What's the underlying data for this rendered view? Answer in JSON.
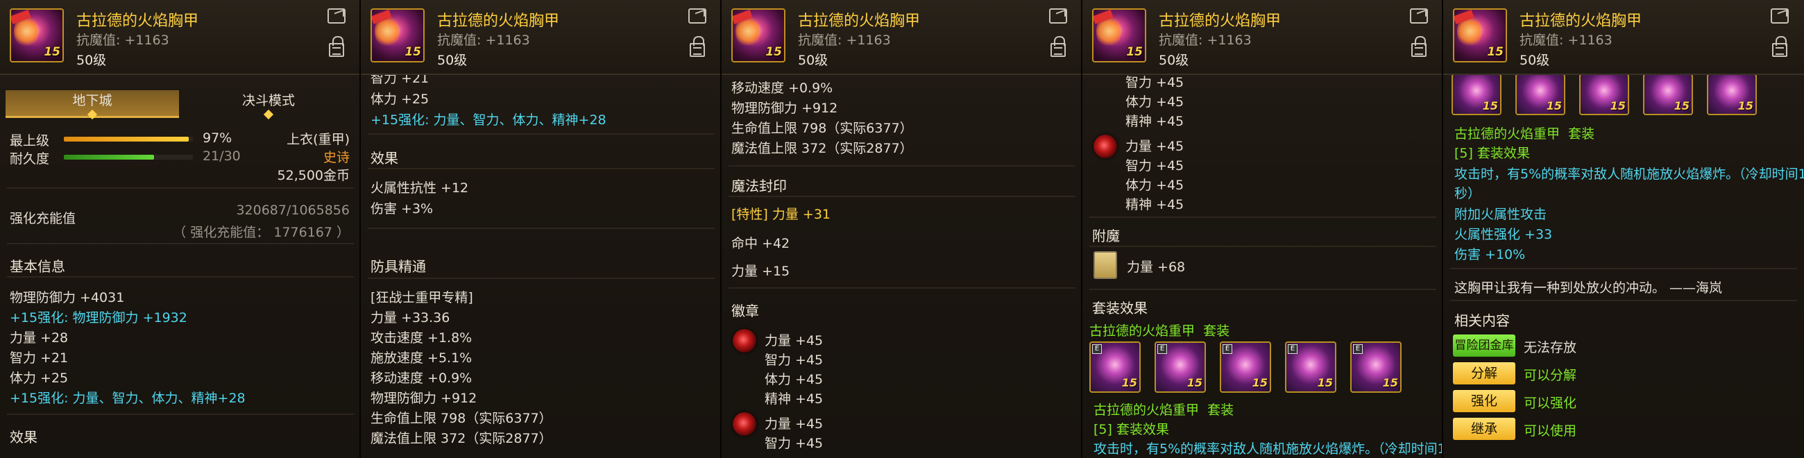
{
  "header": {
    "title": "古拉德的火焰胸甲",
    "armor": "抗魔值: +1163",
    "level": "50级",
    "badge": "15"
  },
  "panel1": {
    "tab1": "地下城",
    "tab2": "决斗模式",
    "durability_top": {
      "label": "最上级",
      "pct": "97%",
      "fill": 0.97
    },
    "durability": {
      "label": "耐久度",
      "value": "21/30",
      "fill": 0.7
    },
    "slot": "上衣(重甲)",
    "rarity": "史诗",
    "price": "52,500金币",
    "enh_label": "强化充能值",
    "enh_val": "320687/1065856",
    "enh_sub": "（ 强化充能值： 1776167 ）",
    "basic_title": "基本信息",
    "lines": [
      "物理防御力 +4031",
      "+15强化: 物理防御力 +1932",
      "力量 +28",
      "智力 +21",
      "体力 +25",
      "+15强化: 力量、智力、体力、精神+28"
    ],
    "effect_title": "效果"
  },
  "panel2": {
    "top": [
      "智力 +21",
      "体力 +25",
      "+15强化: 力量、智力、体力、精神+28"
    ],
    "effect_title": "效果",
    "effects": [
      "火属性抗性 +12",
      "伤害 +3%"
    ],
    "mastery_title": "防具精通",
    "mastery": [
      "[狂战士重甲专精]",
      "力量 +33.36",
      "攻击速度 +1.8%",
      "施放速度 +5.1%",
      "移动速度 +0.9%",
      "物理防御力 +912",
      "生命值上限 798（实际6377）",
      "魔法值上限 372（实际2877）"
    ]
  },
  "panel3": {
    "top": [
      "移动速度 +0.9%",
      "物理防御力 +912",
      "生命值上限 798（实际6377）",
      "魔法值上限 372（实际2877）"
    ],
    "seal_title": "魔法封印",
    "seal": [
      "[特性] 力量 +31",
      "命中 +42",
      "力量 +15"
    ],
    "emblem_title": "徽章",
    "emblem1": [
      "力量 +45",
      "智力 +45",
      "体力 +45",
      "精神 +45"
    ],
    "emblem2": [
      "力量 +45",
      "智力 +45"
    ]
  },
  "panel4": {
    "top": [
      "智力 +45",
      "体力 +45",
      "精神 +45"
    ],
    "emblem2": [
      "力量 +45",
      "智力 +45",
      "体力 +45",
      "精神 +45"
    ],
    "enchant_title": "附魔",
    "enchant": "力量 +68",
    "set_title": "套装效果",
    "set_name": "古拉德的火焰重甲",
    "set_word": "套装",
    "set_name2": "古拉德的火焰重甲",
    "set_word2": "套装",
    "set_bonus": "[5] 套装效果",
    "cut": "攻击时，有5%的概率对敌人随机施放火焰爆炸。（冷却时间1"
  },
  "panel5": {
    "set_name": "古拉德的火焰重甲",
    "set_word": "套装",
    "set_bonus": "[5] 套装效果",
    "desc1": "攻击时，有5%的概率对敌人随机施放火焰爆炸。（冷却时间1",
    "desc2": "秒）",
    "extra": [
      "附加火属性攻击",
      "火属性强化 +33",
      "伤害 +10%"
    ],
    "flavor": "这胸甲让我有一种到处放火的冲动。 ——海岚",
    "related_title": "相关内容",
    "rows": [
      {
        "btn": "冒险团金库",
        "val": "无法存放"
      },
      {
        "btn": "分解",
        "val": "可以分解"
      },
      {
        "btn": "强化",
        "val": "可以强化"
      },
      {
        "btn": "继承",
        "val": "可以使用"
      }
    ]
  }
}
